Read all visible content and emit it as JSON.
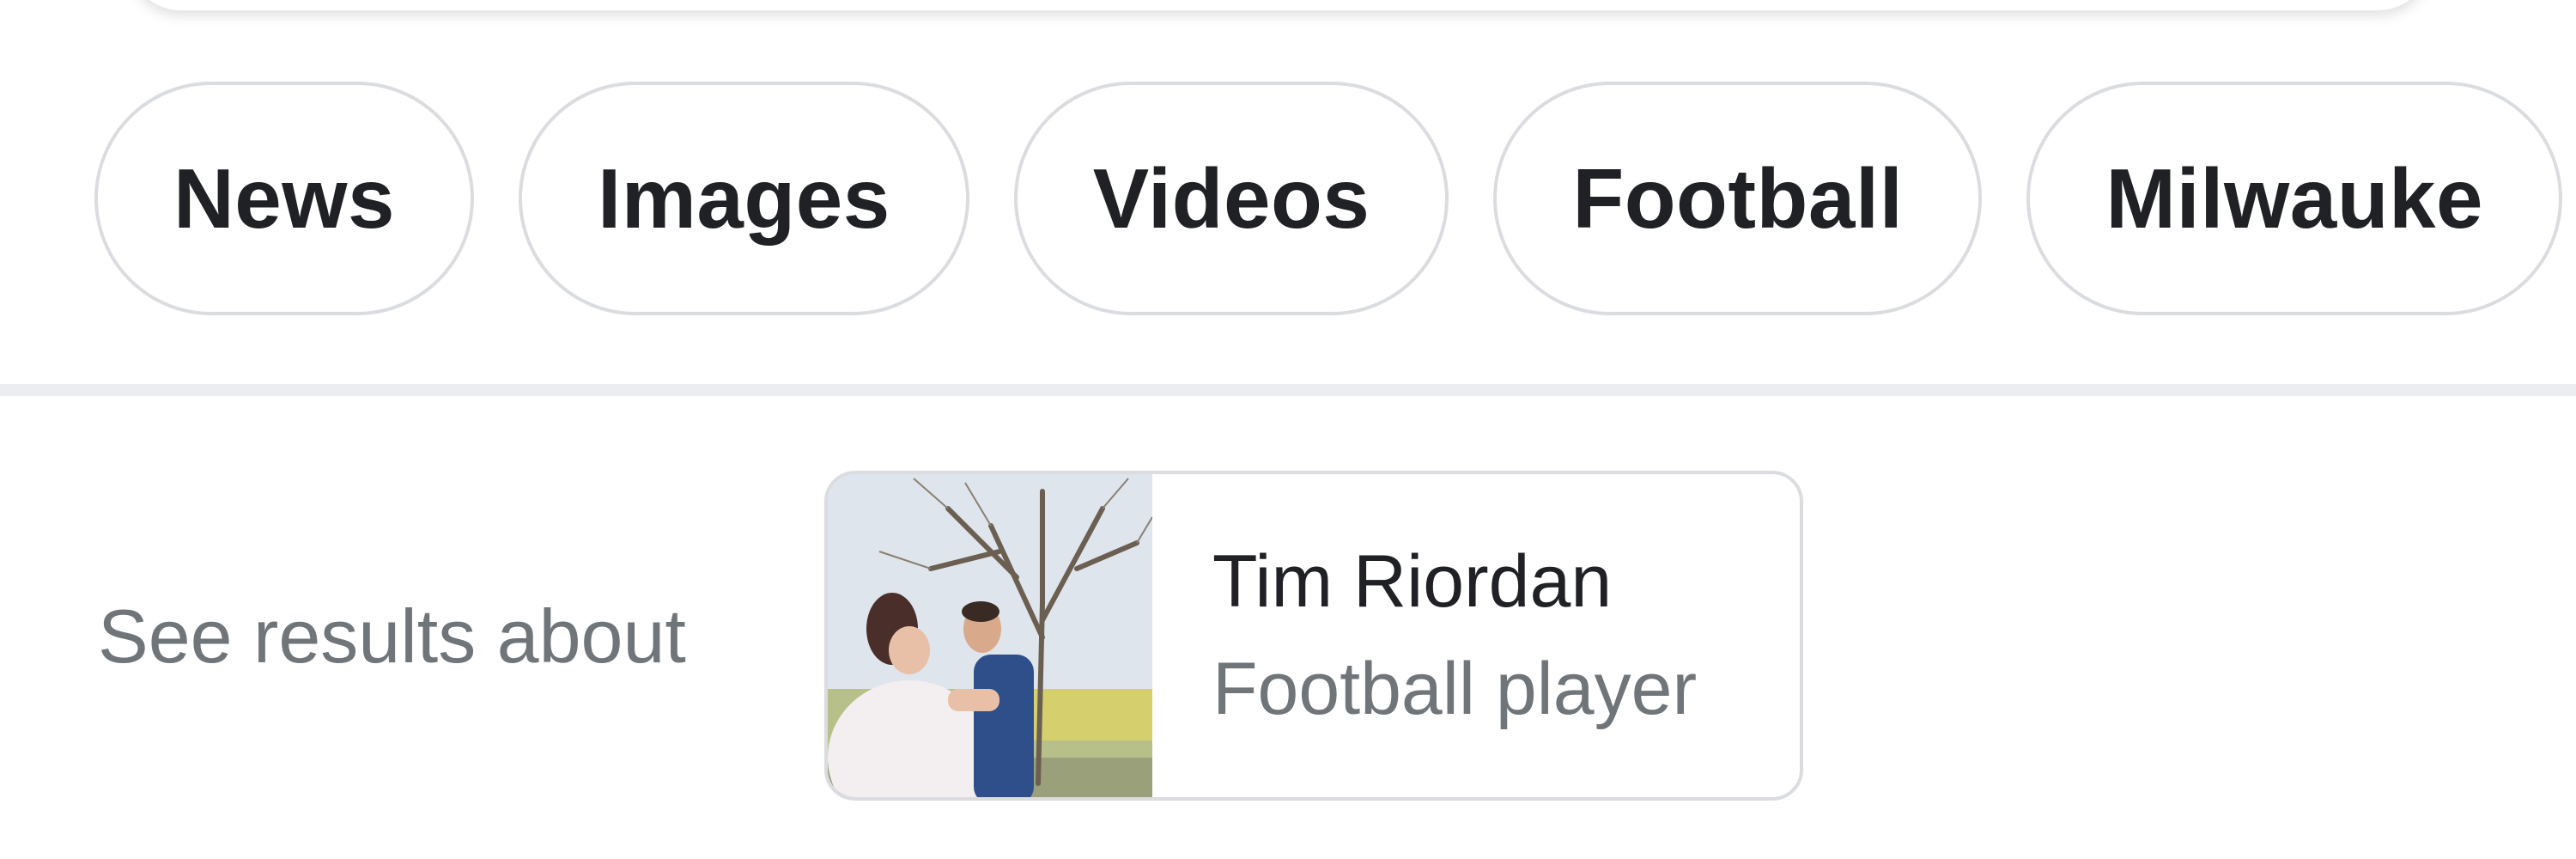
{
  "filter_chips": [
    {
      "label": "News"
    },
    {
      "label": "Images"
    },
    {
      "label": "Videos"
    },
    {
      "label": "Football"
    },
    {
      "label": "Milwauke"
    }
  ],
  "see_results": {
    "label": "See results about",
    "entity": {
      "name": "Tim Riordan",
      "description": "Football player"
    }
  },
  "colors": {
    "chip_border": "#dadce0",
    "chip_text": "#202124",
    "secondary_text": "#70757a",
    "divider": "#ebedf0"
  }
}
